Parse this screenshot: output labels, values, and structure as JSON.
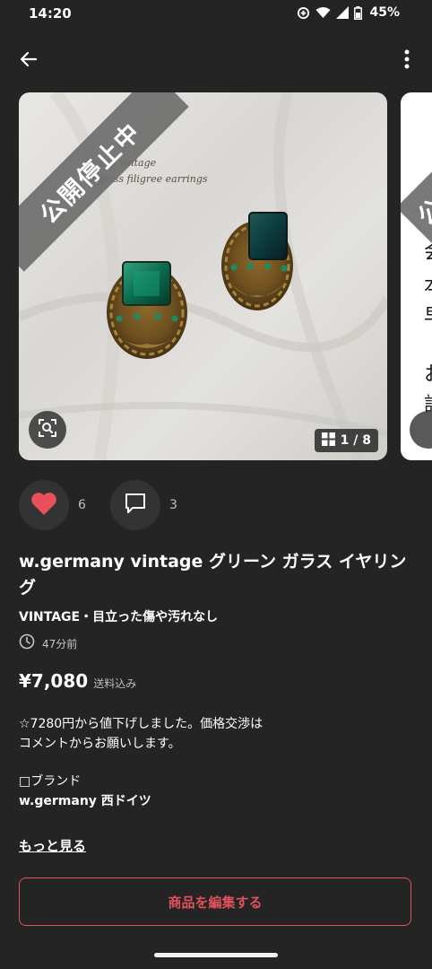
{
  "status_bar": {
    "time": "14:20",
    "battery": "45%",
    "icons": [
      "data-saver-icon",
      "wifi-icon",
      "signal-icon",
      "battery-icon"
    ]
  },
  "top_bar": {
    "back_icon": "arrow-back-icon",
    "menu_icon": "more-vert-icon"
  },
  "gallery": {
    "paused_label": "公開停止中",
    "photo_caption_line1": "many vintage",
    "photo_caption_line2": "n glass filigree earrings",
    "counter": "1 / 8",
    "next_chars": [
      "会",
      "本",
      "早",
      "お",
      "許"
    ]
  },
  "actions": {
    "like_count": "6",
    "comment_count": "3",
    "like_color": "#e8505b"
  },
  "item": {
    "title": "w.germany vintage グリーン ガラス イヤリング",
    "condition": "VINTAGE・目立った傷や汚れなし",
    "posted": "47分前",
    "price": "¥7,080",
    "shipping": "送料込み",
    "description_line1": "☆7280円から値下げしました。価格交渉は",
    "description_line2": "コメントからお願いします。",
    "brand_label": "□ブランド",
    "brand_value": "w.germany 西ドイツ",
    "more": "もっと見る",
    "edit_button": "商品を編集する"
  },
  "colors": {
    "background": "#242424",
    "accent": "#e0525b"
  }
}
